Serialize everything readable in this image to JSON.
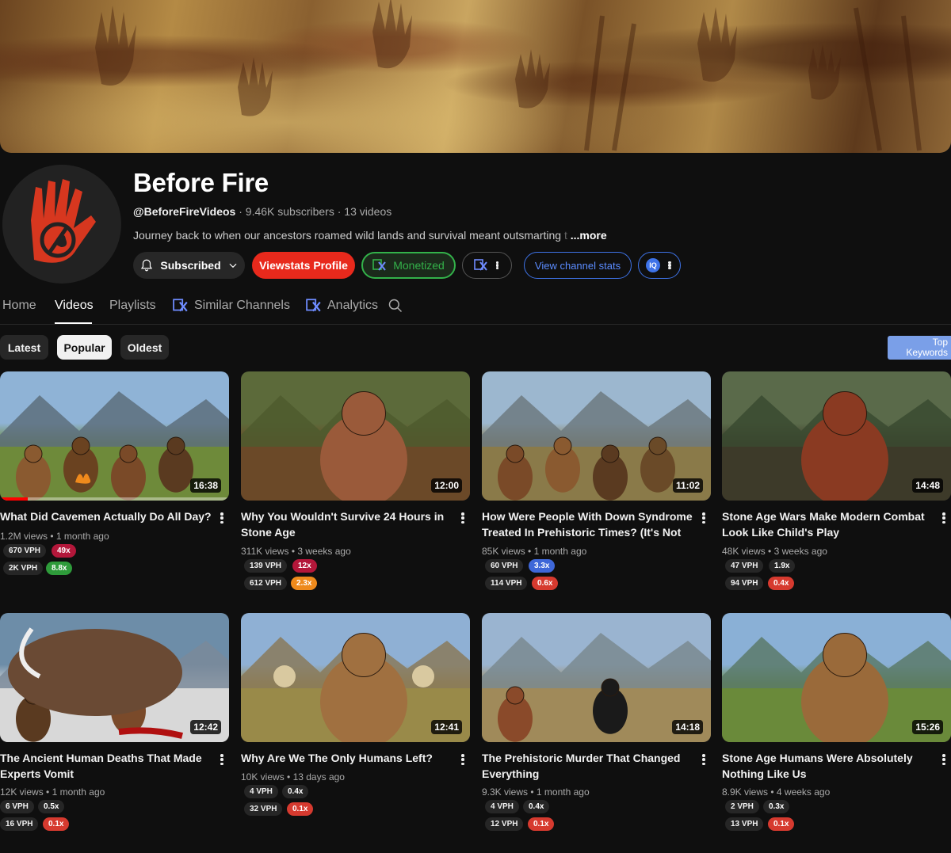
{
  "channel": {
    "name": "Before Fire",
    "handle": "@BeforeFireVideos",
    "subscribers": "9.46K subscribers",
    "videos_count": "13 videos",
    "description": "Journey back to when our ancestors roamed wild lands and survival meant outsmarting",
    "description_fade": "t",
    "more_label": "...more"
  },
  "buttons": {
    "subscribed": "Subscribed",
    "viewstats": "Viewstats Profile",
    "monetized": "Monetized",
    "channel_stats": "View channel stats",
    "iq": "IQ"
  },
  "tabs": {
    "home": "Home",
    "videos": "Videos",
    "playlists": "Playlists",
    "similar": "Similar Channels",
    "analytics": "Analytics"
  },
  "chips": {
    "latest": "Latest",
    "popular": "Popular",
    "oldest": "Oldest"
  },
  "top_keywords": {
    "line1": "Top",
    "line2": "Keywords"
  },
  "colors": {
    "pill_red": "#d63a2f",
    "pill_darkred": "#b3173a",
    "pill_green": "#2e9b3a",
    "pill_blue": "#3e67d8",
    "pill_orange": "#ee8a1c",
    "pill_neutral": "#262626"
  },
  "videos": [
    {
      "title": "What Did Cavemen Actually Do All Day?",
      "duration": "16:38",
      "views": "1.2M views",
      "age": "1 month ago",
      "vph1": "670 VPH",
      "x1": "49x",
      "vph2": "2K VPH",
      "x2": "8.8x",
      "progress": 0.12
    },
    {
      "title": "Why You Wouldn't Survive 24 Hours in Stone Age",
      "duration": "12:00",
      "views": "311K views",
      "age": "3 weeks ago",
      "vph1": "139 VPH",
      "x1": "12x",
      "vph2": "612 VPH",
      "x2": "2.3x"
    },
    {
      "title": "How Were People With Down Syndrome Treated In Prehistoric Times? (It's Not What...",
      "duration": "11:02",
      "views": "85K views",
      "age": "1 month ago",
      "vph1": "60 VPH",
      "x1": "3.3x",
      "vph2": "114 VPH",
      "x2": "0.6x"
    },
    {
      "title": "Stone Age Wars Make Modern Combat Look Like Child's Play",
      "duration": "14:48",
      "views": "48K views",
      "age": "3 weeks ago",
      "vph1": "47 VPH",
      "x1": "1.9x",
      "vph2": "94 VPH",
      "x2": "0.4x"
    },
    {
      "title": "The Ancient Human Deaths That Made Experts Vomit",
      "duration": "12:42",
      "views": "12K views",
      "age": "1 month ago",
      "vph1": "6 VPH",
      "x1": "0.5x",
      "vph2": "16 VPH",
      "x2": "0.1x"
    },
    {
      "title": "Why Are We The Only Humans Left?",
      "duration": "12:41",
      "views": "10K views",
      "age": "13 days ago",
      "vph1": "4 VPH",
      "x1": "0.4x",
      "vph2": "32 VPH",
      "x2": "0.1x"
    },
    {
      "title": "The Prehistoric Murder That Changed Everything",
      "duration": "14:18",
      "views": "9.3K views",
      "age": "1 month ago",
      "vph1": "4 VPH",
      "x1": "0.4x",
      "vph2": "12 VPH",
      "x2": "0.1x"
    },
    {
      "title": "Stone Age Humans Were Absolutely Nothing Like Us",
      "duration": "15:26",
      "views": "8.9K views",
      "age": "4 weeks ago",
      "vph1": "2 VPH",
      "x1": "0.3x",
      "vph2": "13 VPH",
      "x2": "0.1x"
    }
  ]
}
